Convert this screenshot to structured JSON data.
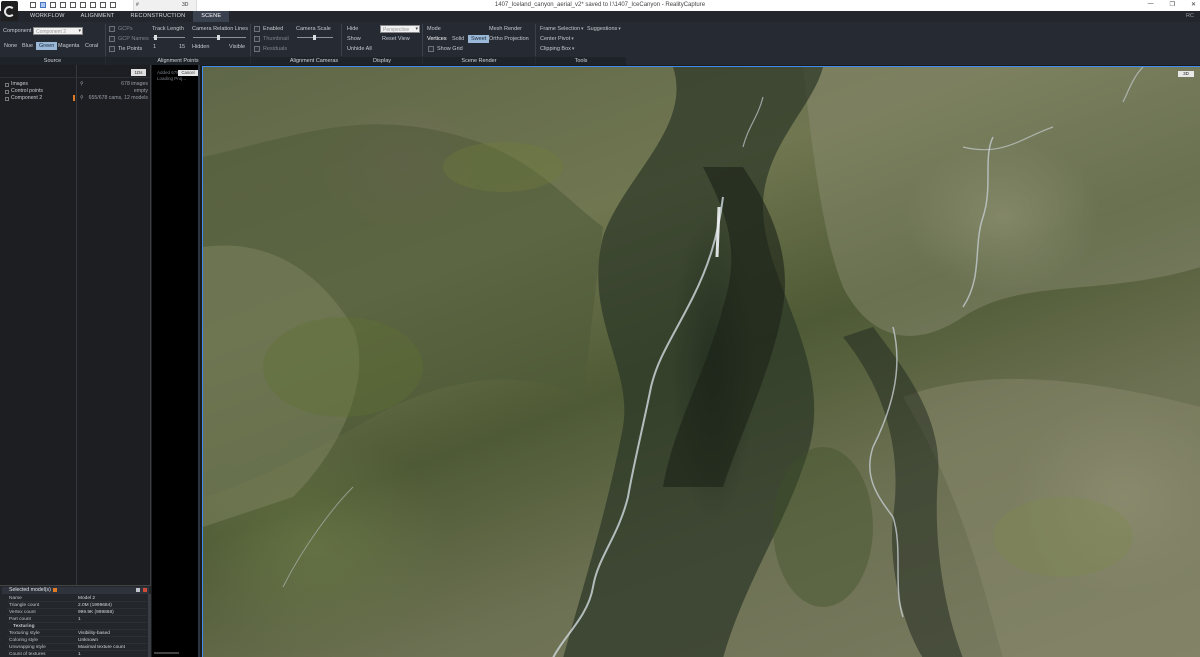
{
  "window": {
    "title": "1407_Iceland_canyon_aerial_v2* saved to I:\\1407_IceCanyon - RealityCapture",
    "tab_left": "#",
    "tab_right": "3D",
    "controls": [
      "—",
      "❐",
      "✕"
    ]
  },
  "menu": {
    "tabs": [
      "WORKFLOW",
      "ALIGNMENT",
      "RECONSTRUCTION",
      "SCENE"
    ],
    "active_tab": "SCENE",
    "right_label": "RC"
  },
  "ribbon": {
    "source": {
      "component_label": "Component",
      "component_value": "Component 2",
      "colors": [
        "None",
        "Blue",
        "Green",
        "Magenta",
        "Coral"
      ],
      "selected_color": "Green",
      "label": "Source"
    },
    "alignment_points": {
      "gcps": "GCPs",
      "gcp_names": "GCP Names",
      "tie_points": "Tie Points",
      "track_length": "Track Length",
      "track_min": "1",
      "track_max": "15",
      "camera_relation_lines": "Camera Relation Lines",
      "hidden": "Hidden",
      "visible": "Visible",
      "label": "Alignment Points"
    },
    "alignment_cameras": {
      "enabled": "Enabled",
      "thumbnail": "Thumbnail",
      "residuals": "Residuals",
      "camera_scale": "Camera Scale",
      "label": "Alignment Cameras"
    },
    "display": {
      "hide": "Hide",
      "show": "Show",
      "unhide_all": "Unhide All",
      "projection_value": "Perspective",
      "reset_view": "Reset View",
      "label": "Display"
    },
    "scene_render": {
      "mode": "Mode",
      "vertices": "Vertices",
      "solid": "Solid",
      "sweet": "Sweet",
      "show_grid": "Show Grid",
      "mesh_render": "Mesh Render",
      "ortho_projection": "Ortho Projection",
      "label": "Scene Render"
    },
    "tools": {
      "frame_selection": "Frame Selection",
      "suggestions": "Suggestions",
      "center_pivot": "Center Pivot",
      "clipping_box": "Clipping Box",
      "label": "Tools"
    }
  },
  "left_panel": {
    "toolbar_button": "1Ds",
    "tree": [
      {
        "name": "Images",
        "value": "678 images"
      },
      {
        "name": "Control points",
        "value": "empty"
      },
      {
        "name": "Component 2",
        "value": "655/678 cams, 12 models"
      }
    ]
  },
  "log": {
    "lines": [
      "Added 678 images",
      "Loading Proj..."
    ],
    "button": "Cancel"
  },
  "properties": {
    "title": "Selected model(s)",
    "rows": [
      {
        "key": "Name",
        "value": "Model 2"
      },
      {
        "key": "Triangle count",
        "value": "2.0M (1999684)"
      },
      {
        "key": "Vertex count",
        "value": "999.9K (999868)"
      },
      {
        "key": "Part count",
        "value": "1"
      }
    ],
    "section": "Texturing",
    "section_rows": [
      {
        "key": "Texturing style",
        "value": "Visibility-based"
      },
      {
        "key": "Coloring style",
        "value": "Unknown"
      },
      {
        "key": "Unwrapping style",
        "value": "Maximal texture count"
      },
      {
        "key": "Count of textures",
        "value": "1"
      }
    ]
  },
  "viewport": {
    "badge": "3D",
    "accent_color": "#3f8cf0"
  }
}
